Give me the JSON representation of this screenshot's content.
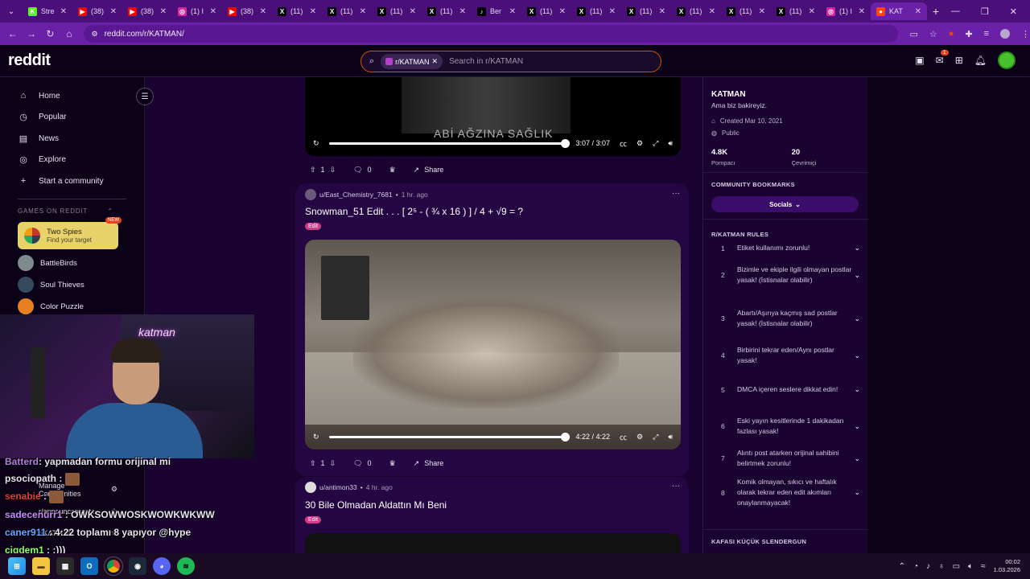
{
  "browser": {
    "tabs": [
      {
        "label": "Stre",
        "icon": "K",
        "color": "#53fc18"
      },
      {
        "label": "(38)",
        "icon": "▶",
        "color": "#ff0000"
      },
      {
        "label": "(38)",
        "icon": "▶",
        "color": "#ff0000"
      },
      {
        "label": "(1) I",
        "icon": "◎",
        "color": "#d6249f"
      },
      {
        "label": "(38)",
        "icon": "▶",
        "color": "#ff0000"
      },
      {
        "label": "(11)",
        "icon": "X",
        "color": "#000000"
      },
      {
        "label": "(11)",
        "icon": "X",
        "color": "#000000"
      },
      {
        "label": "(11)",
        "icon": "X",
        "color": "#000000"
      },
      {
        "label": "(11)",
        "icon": "X",
        "color": "#000000"
      },
      {
        "label": "Ber",
        "icon": "♪",
        "color": "#000000"
      },
      {
        "label": "(11)",
        "icon": "X",
        "color": "#000000"
      },
      {
        "label": "(11)",
        "icon": "X",
        "color": "#000000"
      },
      {
        "label": "(11)",
        "icon": "X",
        "color": "#000000"
      },
      {
        "label": "(11)",
        "icon": "X",
        "color": "#000000"
      },
      {
        "label": "(11)",
        "icon": "X",
        "color": "#000000"
      },
      {
        "label": "(11)",
        "icon": "X",
        "color": "#000000"
      },
      {
        "label": "(1) I",
        "icon": "◎",
        "color": "#d6249f"
      },
      {
        "label": "KAT",
        "icon": "●",
        "color": "#ff4500",
        "active": true
      }
    ],
    "url": "reddit.com/r/KATMAN/"
  },
  "header": {
    "logo": "reddit",
    "chip": "r/KATMAN",
    "search_placeholder": "Search in r/KATMAN",
    "notif_count": "1"
  },
  "sidebar": {
    "nav": [
      {
        "label": "Home",
        "icon": "⌂"
      },
      {
        "label": "Popular",
        "icon": "◷"
      },
      {
        "label": "News",
        "icon": "▤"
      },
      {
        "label": "Explore",
        "icon": "◎"
      },
      {
        "label": "Start a community",
        "icon": "+"
      }
    ],
    "games_heading": "GAMES ON REDDIT",
    "promo": {
      "title": "Two Spies",
      "subtitle": "Find your target",
      "badge": "NEW"
    },
    "games": [
      {
        "label": "BattleBirds",
        "color": "#7f8c8d"
      },
      {
        "label": "Soul Thieves",
        "color": "#34495e"
      },
      {
        "label": "Color Puzzle",
        "color": "#e67e22"
      }
    ],
    "lower": [
      {
        "label": "Manage Communities",
        "icon": "⚙"
      },
      {
        "label": "r/announcements",
        "icon": "☆"
      },
      {
        "label": "r/KATMAN",
        "icon": "☆"
      }
    ]
  },
  "posts": [
    {
      "caption": "ABİ AĞZINA SAĞLIK",
      "time_display": "3:07 / 3:07",
      "votes": "1",
      "comments": "0",
      "share": "Share"
    },
    {
      "author": "u/East_Chemistry_7681",
      "time": "1 hr. ago",
      "title": "Snowman_51 Edit . . . [ 2⁵ - ( ¾ x 16 ) ] / 4 + √9 = ?",
      "flair": "Edit",
      "time_display": "4:22 / 4:22",
      "votes": "1",
      "comments": "0",
      "share": "Share"
    },
    {
      "author": "u/antimon33",
      "time": "4 hr. ago",
      "title": "30 Bile Olmadan Aldattın Mı Beni",
      "flair": "Edit"
    }
  ],
  "community": {
    "name": "KATMAN",
    "description": "Ama biz bakireyiz.",
    "created": "Created Mar 10, 2021",
    "visibility": "Public",
    "members": "4.8K",
    "members_label": "Pompacı",
    "online": "20",
    "online_label": "Çevrimiçi",
    "bookmarks_heading": "COMMUNITY BOOKMARKS",
    "socials": "Socials",
    "rules_heading": "R/KATMAN RULES",
    "rules": [
      {
        "num": "1",
        "text": "Etiket kullanımı zorunlu!"
      },
      {
        "num": "2",
        "text": "Bizimle ve ekiple ilgili olmayan postlar yasak! (İstisnalar olabilir)"
      },
      {
        "num": "3",
        "text": "Abartı/Aşırıya kaçmış sad postlar yasak! (İstisnalar olabilir)"
      },
      {
        "num": "4",
        "text": "Birbirini tekrar eden/Aynı postlar yasak!"
      },
      {
        "num": "5",
        "text": "DMCA içeren seslere dikkat edin!"
      },
      {
        "num": "6",
        "text": "Eski yayın kesitlerinde 1 dakikadan fazlası yasak!"
      },
      {
        "num": "7",
        "text": "Alıntı post atarken orijinal sahibini belirtmek zorunlu!"
      },
      {
        "num": "8",
        "text": "Komik olmayan, sıkıcı ve haftalık olarak tekrar eden edit akımları onaylanmayacak!"
      }
    ],
    "next_section": "KAFASI KÜÇÜK SLENDERGUN"
  },
  "chat": [
    {
      "user": "Batterd",
      "msg": ": yapmadan formu orijinal mi",
      "color": "#b57edc"
    },
    {
      "user": "psociopath",
      "msg": " : ",
      "color": "#e8e2f2"
    },
    {
      "user": "senabie",
      "msg": " : ",
      "color": "#e83a3a"
    },
    {
      "user": "sadecenurr1",
      "msg": " : OWKSOWWOSKWOWKWKWW",
      "color": "#c98bff"
    },
    {
      "user": "caner911",
      "msg": " : 4:22 toplamı 8 yapıyor @hype",
      "color": "#6aa5ff"
    },
    {
      "user": "cigdem1",
      "msg": " : :)))",
      "color": "#8cff6a"
    }
  ],
  "overlay": {
    "neon": "katman"
  },
  "taskbar": {
    "time": "00:02",
    "date": "1.03.2026"
  }
}
